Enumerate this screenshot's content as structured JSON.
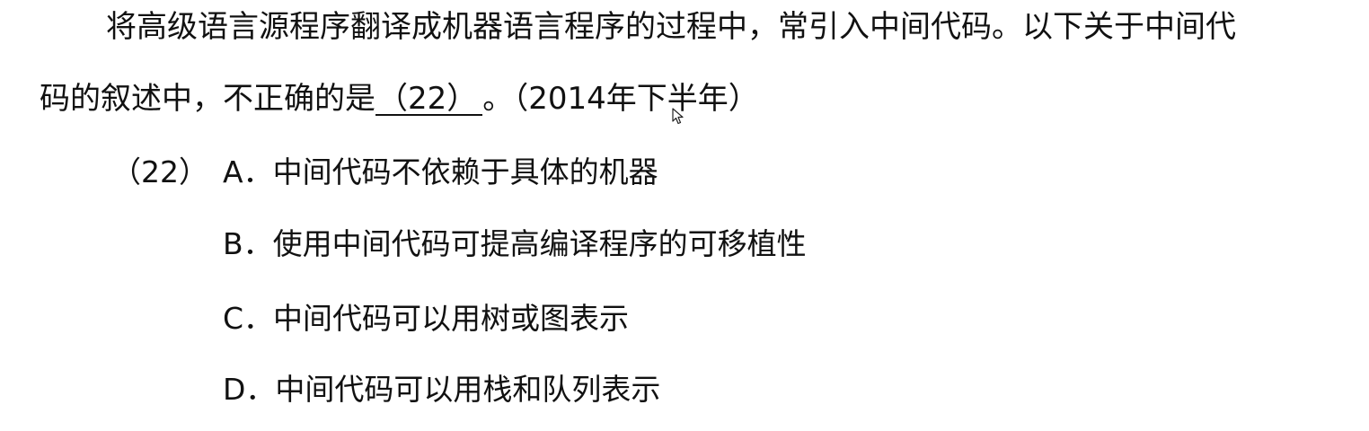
{
  "question": {
    "line1": "将高级语言源程序翻译成机器语言程序的过程中，常引入中间代码。以下关于中间代",
    "line2_prefix": "码的叙述中，不正确的是",
    "blank": "（22）",
    "line2_suffix": "。（2014年下半年）"
  },
  "options_number": "（22）",
  "options": [
    {
      "letter": "A．",
      "text": "中间代码不依赖于具体的机器"
    },
    {
      "letter": "B．",
      "text": "使用中间代码可提高编译程序的可移植性"
    },
    {
      "letter": "C．",
      "text": "中间代码可以用树或图表示"
    },
    {
      "letter": "D．",
      "text": "中间代码可以用栈和队列表示"
    }
  ],
  "icons": {
    "cursor": "mouse-pointer-icon"
  }
}
